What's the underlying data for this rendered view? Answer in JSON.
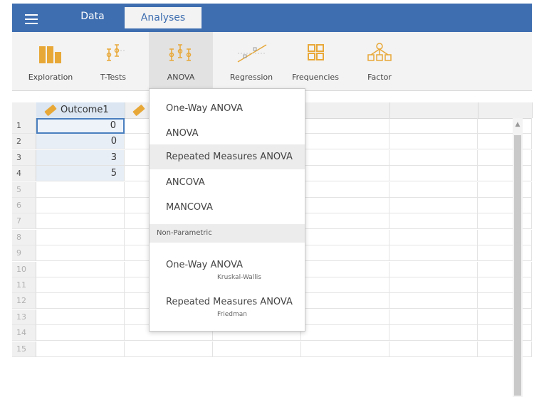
{
  "tabs": {
    "data": "Data",
    "analyses": "Analyses"
  },
  "ribbon": {
    "exploration": "Exploration",
    "ttests": "T-Tests",
    "anova": "ANOVA",
    "regression": "Regression",
    "frequencies": "Frequencies",
    "factor": "Factor"
  },
  "sheet": {
    "column1": "Outcome1",
    "values": [
      "0",
      "0",
      "3",
      "5"
    ],
    "rows": [
      "1",
      "2",
      "3",
      "4",
      "5",
      "6",
      "7",
      "8",
      "9",
      "10",
      "11",
      "12",
      "13",
      "14",
      "15"
    ]
  },
  "anova_menu": {
    "items": [
      "One-Way ANOVA",
      "ANOVA",
      "Repeated Measures ANOVA",
      "ANCOVA",
      "MANCOVA"
    ],
    "section": "Non-Parametric",
    "np_items": [
      {
        "label": "One-Way ANOVA",
        "sub": "Kruskal-Wallis"
      },
      {
        "label": "Repeated Measures ANOVA",
        "sub": "Friedman"
      }
    ]
  },
  "colors": {
    "brand": "#3e6eb0",
    "accent": "#e8a838",
    "column": "#dbe6f2"
  }
}
